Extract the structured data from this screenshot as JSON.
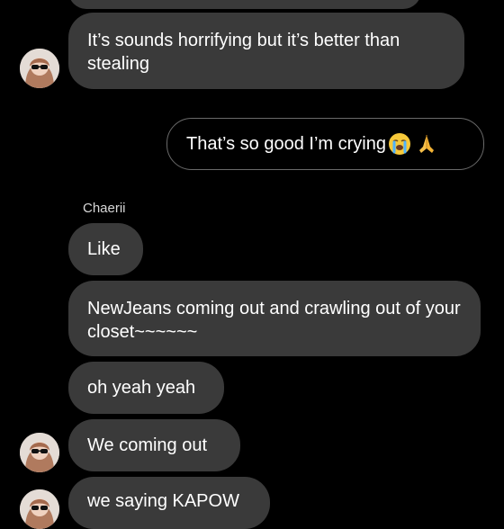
{
  "conversation": {
    "messages": [
      {
        "text": "It’s sounds horrifying but it’s better than stealing"
      },
      {
        "text": "That’s so good I’m crying"
      },
      {
        "text": "Like"
      },
      {
        "text": "NewJeans coming out and crawling out of your closet~~~~~~"
      },
      {
        "text": "oh yeah yeah"
      },
      {
        "text": "We coming out"
      },
      {
        "text": "we saying KAPOW"
      }
    ],
    "sender_name": "Chaerii",
    "emojis": [
      "crying-face",
      "folded-hands"
    ]
  }
}
